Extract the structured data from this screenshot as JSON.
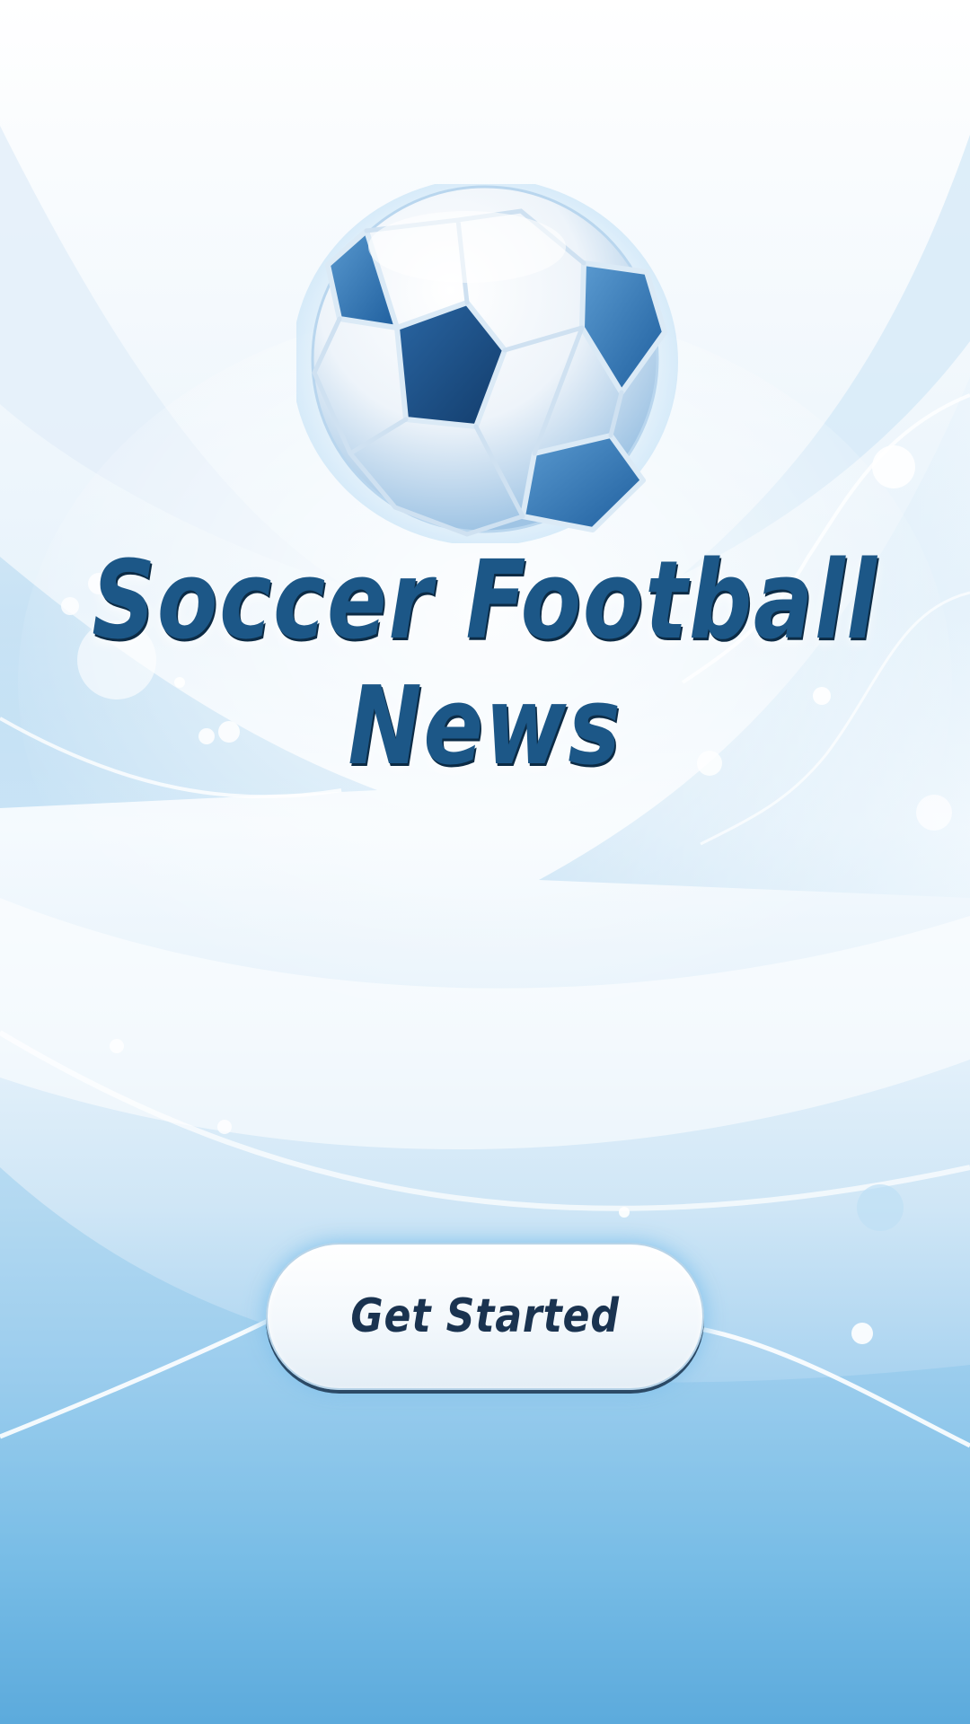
{
  "app": {
    "title_line1": "Soccer Football",
    "title_line2": "News"
  },
  "actions": {
    "get_started_label": "Get Started"
  },
  "colors": {
    "title": "#1c5787",
    "button_text": "#1a3350",
    "accent_blue": "#4a9fd6"
  },
  "icons": {
    "hero": "soccer-ball-icon"
  }
}
